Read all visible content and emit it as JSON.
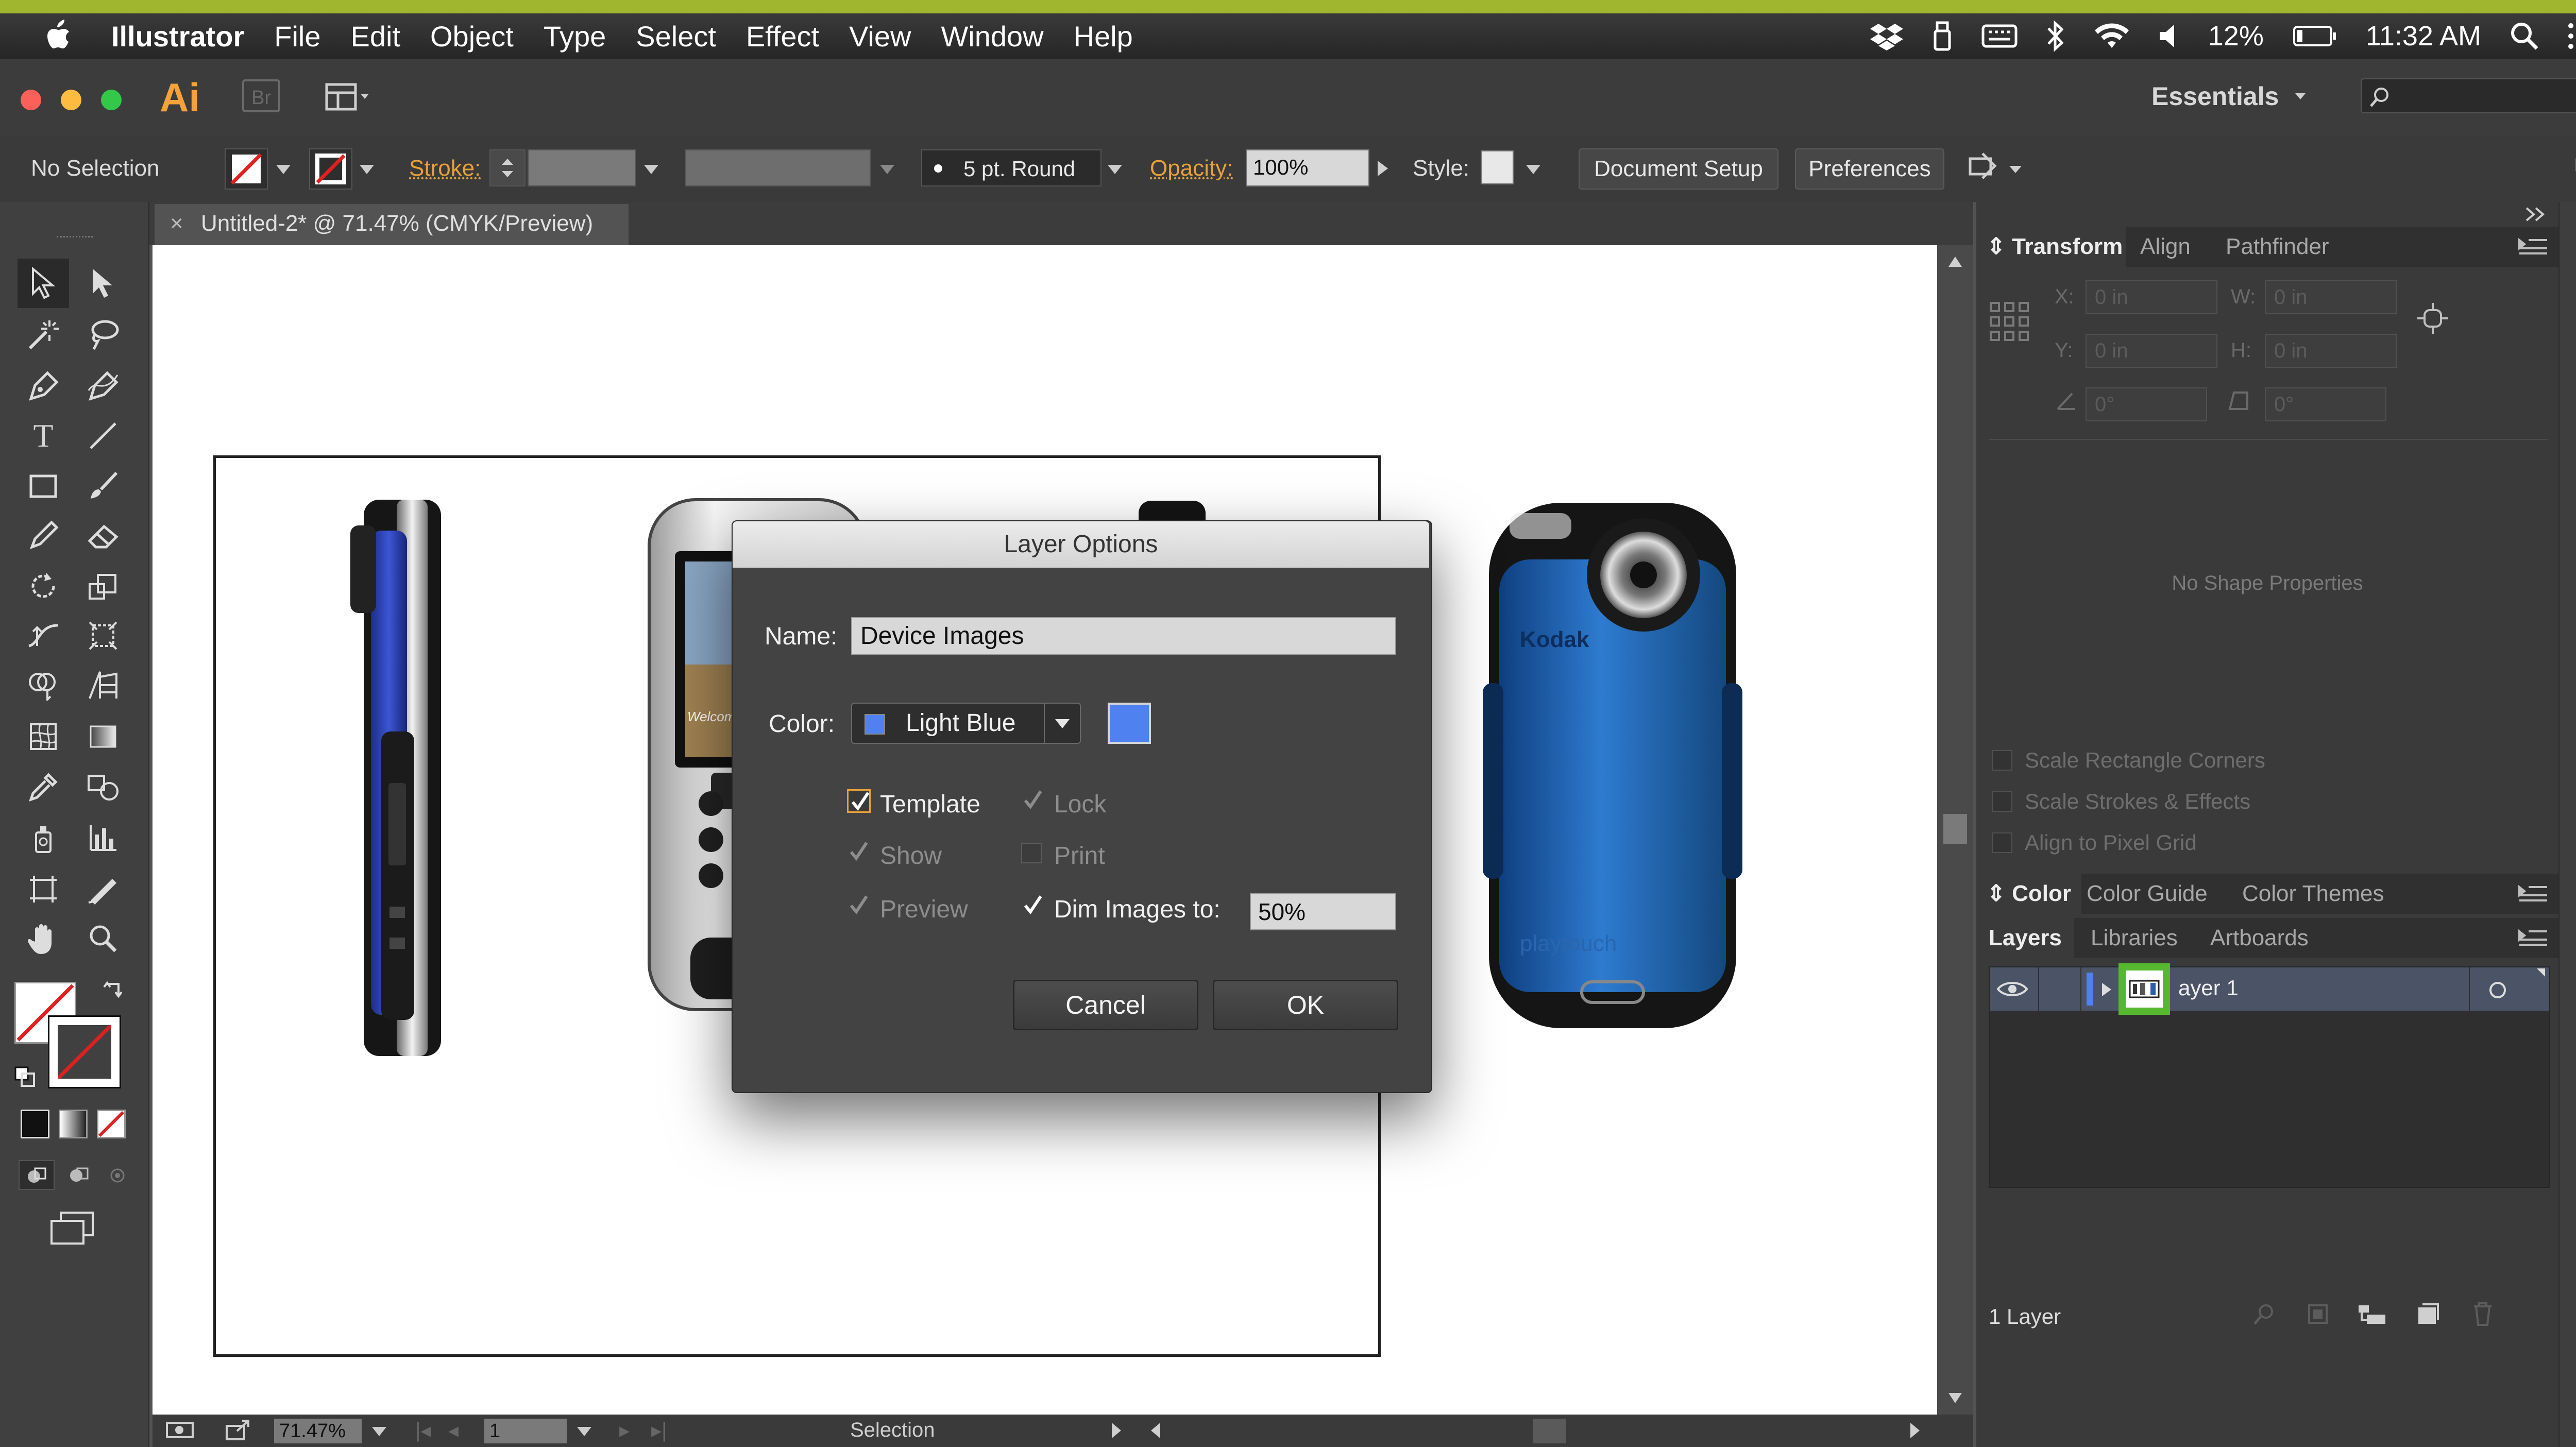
{
  "menubar": {
    "app_name": "Illustrator",
    "items": [
      "File",
      "Edit",
      "Object",
      "Type",
      "Select",
      "Effect",
      "View",
      "Window",
      "Help"
    ],
    "battery": "12%",
    "clock": "11:32 AM"
  },
  "appbar": {
    "logo": "Ai",
    "bridge": "Br",
    "workspace": "Essentials"
  },
  "controlbar": {
    "selection": "No Selection",
    "stroke_label": "Stroke:",
    "brush": "5 pt. Round",
    "opacity_label": "Opacity:",
    "opacity_value": "100%",
    "style_label": "Style:",
    "document_setup": "Document Setup",
    "preferences": "Preferences"
  },
  "document": {
    "tab_close": "×",
    "tab_title": "Untitled-2* @ 71.47% (CMYK/Preview)"
  },
  "statusbar": {
    "zoom": "71.47%",
    "artboard": "1",
    "tool": "Selection"
  },
  "dialog": {
    "title": "Layer Options",
    "name_label": "Name:",
    "name_value": "Device Images",
    "color_label": "Color:",
    "color_value": "Light Blue",
    "color_hex": "#4f82f0",
    "template_label": "Template",
    "template_checked": true,
    "lock_label": "Lock",
    "show_label": "Show",
    "print_label": "Print",
    "preview_label": "Preview",
    "dim_label": "Dim Images to:",
    "dim_value": "50%",
    "cancel": "Cancel",
    "ok": "OK"
  },
  "transform_panel": {
    "tabs": [
      "Transform",
      "Align",
      "Pathfinder"
    ],
    "x_label": "X:",
    "x_value": "0 in",
    "y_label": "Y:",
    "y_value": "0 in",
    "w_label": "W:",
    "w_value": "0 in",
    "h_label": "H:",
    "h_value": "0 in",
    "angle_value": "0°",
    "shear_value": "0°",
    "empty_message": "No Shape Properties",
    "options": [
      "Scale Rectangle Corners",
      "Scale Strokes & Effects",
      "Align to Pixel Grid"
    ]
  },
  "color_panel": {
    "tabs": [
      "Color",
      "Color Guide",
      "Color Themes"
    ]
  },
  "layers_panel": {
    "tabs": [
      "Layers",
      "Libraries",
      "Artboards"
    ],
    "layer_name": "ayer 1",
    "layer_count": "1 Layer",
    "layer_color": "#4f82f0"
  },
  "canvas": {
    "brand_text": "Kodak",
    "brand_text_2": "playtouch",
    "small_label": "Welcome"
  },
  "colors": {
    "highlight": "#55b82e",
    "accent_orange": "#e8a13a",
    "camera_blue": "#1f5fa8"
  }
}
